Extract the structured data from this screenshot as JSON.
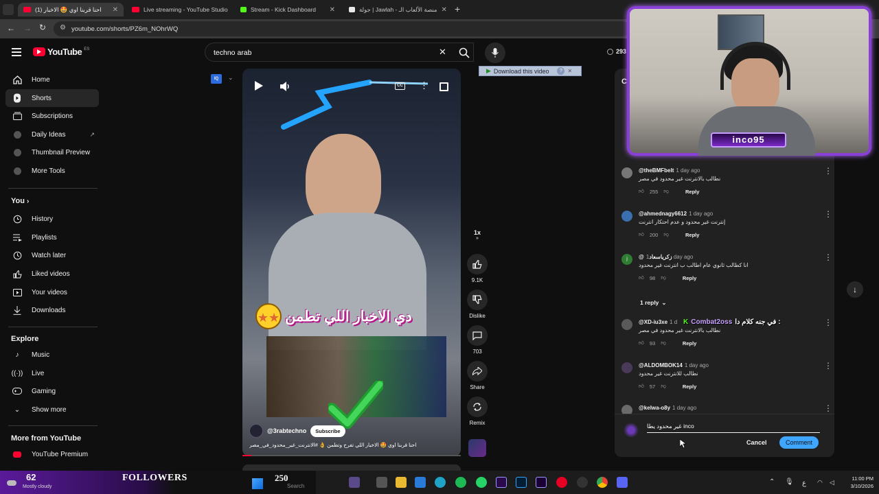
{
  "tabs": [
    {
      "title": "(1) احنا قربنا اوي 🤩 الاخبار",
      "color": "#ff0033",
      "active": true
    },
    {
      "title": "Live streaming - YouTube Studio",
      "color": "#ff0033",
      "active": false
    },
    {
      "title": "Stream - Kick Dashboard",
      "color": "#53fc18",
      "active": false
    },
    {
      "title": "جولة | Jawlah - منصة الألعاب الـ",
      "color": "#e8e8e8",
      "active": false
    }
  ],
  "address": {
    "url": "youtube.com/shorts/PZ6m_NOhrWQ"
  },
  "header": {
    "logo": "YouTube",
    "region": "ES",
    "search_value": "techno arab",
    "notif_count": "293"
  },
  "sidebar": {
    "top": [
      {
        "label": "Home",
        "icon": "home-icon"
      },
      {
        "label": "Shorts",
        "icon": "shorts-icon"
      },
      {
        "label": "Subscriptions",
        "icon": "subscriptions-icon"
      },
      {
        "label": "Daily Ideas",
        "icon": "daily-ideas-icon"
      },
      {
        "label": "Thumbnail Preview",
        "icon": "thumbnail-preview-icon"
      },
      {
        "label": "More Tools",
        "icon": "more-tools-icon"
      }
    ],
    "you_title": "You",
    "you": [
      {
        "label": "History",
        "icon": "history-icon"
      },
      {
        "label": "Playlists",
        "icon": "playlists-icon"
      },
      {
        "label": "Watch later",
        "icon": "watch-later-icon"
      },
      {
        "label": "Liked videos",
        "icon": "liked-videos-icon"
      },
      {
        "label": "Your videos",
        "icon": "your-videos-icon"
      },
      {
        "label": "Downloads",
        "icon": "downloads-icon"
      }
    ],
    "explore_title": "Explore",
    "explore": [
      {
        "label": "Music",
        "icon": "music-icon"
      },
      {
        "label": "Live",
        "icon": "live-icon"
      },
      {
        "label": "Gaming",
        "icon": "gaming-icon"
      },
      {
        "label": "Show more",
        "icon": "chevron-down-icon"
      }
    ],
    "more_title": "More from YouTube",
    "more": [
      {
        "label": "YouTube Premium",
        "icon": "youtube-premium-icon"
      }
    ]
  },
  "video": {
    "download_label": "Download this video",
    "overlay_text": "دي الاخبار اللي تطمن",
    "channel": "@3rabtechno",
    "subscribe": "Subscribe",
    "caption": "احنا قربنا اوي 🤩 الاخبار اللي تفرح وتطمن 👌 #الانترنت_غير_محدود_في_مصر",
    "speed": "1x"
  },
  "actions": {
    "likes": "9.1K",
    "dislike": "Dislike",
    "comments": "703",
    "share": "Share",
    "remix": "Remix"
  },
  "comments": [
    {
      "user": "@theBMFbelt",
      "time": "1 day ago",
      "text": "نطالب بالانترنت غير محدود في مصر",
      "likes": "255",
      "reply": "Reply",
      "avatar": "#777777"
    },
    {
      "user": "@ahmednagy6612",
      "time": "1 day ago",
      "text": "إنترنت غير محدود و عدم احتكار انترنت",
      "likes": "200",
      "reply": "Reply",
      "avatar": "#3a6fb0"
    },
    {
      "user": "@زكرياسعاد",
      "time": "1 day ago",
      "text": "انا كطالب ثانوي عام اطالب ب انترنت غير محدود",
      "likes": "98",
      "reply": "Reply",
      "avatar": "#2e7d32"
    },
    {
      "user": "@XD-iu3xe",
      "time": "1 d",
      "text": "نطالب بالانترنت غير محدود في مصر",
      "likes": "93",
      "reply": "Reply",
      "avatar": "#5a5a5a"
    },
    {
      "user": "@ALDOMBOK14",
      "time": "1 day ago",
      "text": "نطالب للانترنت غير محدود",
      "likes": "57",
      "reply": "Reply",
      "avatar": "#4a3a5a"
    },
    {
      "user": "@kelwa-o8y",
      "time": "1 day ago",
      "text": "",
      "likes": "",
      "reply": "",
      "avatar": "#6a6a6a"
    }
  ],
  "replies_toggle": "1 reply",
  "kick_chat": {
    "user": "Combat2oss",
    "text": "في جنه كلام دا :"
  },
  "comment_box": {
    "value": "غير محدود يطا inco",
    "cancel": "Cancel",
    "submit": "Comment"
  },
  "stream_overlay": {
    "streamer": "inco95",
    "followers_count": "62",
    "followers_label": "FOLLOWERS",
    "goal": "250",
    "weather": "Mostly cloudy"
  },
  "taskbar": {
    "search": "Search",
    "time": "11:00 PM",
    "date": "3/10/2026",
    "lang": "ع"
  }
}
